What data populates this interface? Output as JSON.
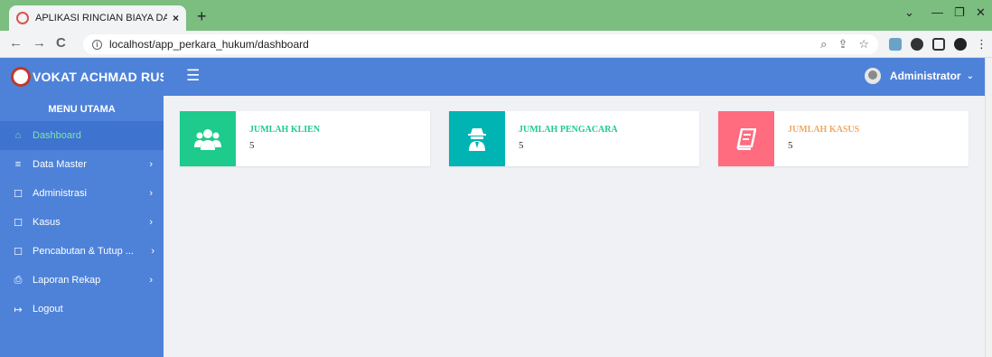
{
  "browser": {
    "tab_title": "APLIKASI RINCIAN BIAYA DAN AL",
    "tab_close": "×",
    "new_tab": "+",
    "url": "localhost/app_perkara_hukum/dashboard"
  },
  "header": {
    "brand": "VOKAT ACHMAD RUSI",
    "user_name": "Administrator"
  },
  "sidebar": {
    "heading": "MENU UTAMA",
    "items": [
      {
        "label": "Dashboard",
        "icon": "home-icon",
        "active": true,
        "has_arrow": false
      },
      {
        "label": "Data Master",
        "icon": "list-icon",
        "has_arrow": true
      },
      {
        "label": "Administrasi",
        "icon": "square-icon",
        "has_arrow": true
      },
      {
        "label": "Kasus",
        "icon": "square-icon",
        "has_arrow": true
      },
      {
        "label": "Pencabutan & Tutup ...",
        "icon": "square-icon",
        "has_arrow": true
      },
      {
        "label": "Laporan Rekap",
        "icon": "printer-icon",
        "has_arrow": true
      },
      {
        "label": "Logout",
        "icon": "logout-icon",
        "has_arrow": false
      }
    ]
  },
  "cards": [
    {
      "title": "JUMLAH KLIEN",
      "value": "5",
      "icon": "users-icon",
      "color": "#1ecb8c",
      "title_color": "#1ecb8c"
    },
    {
      "title": "JUMLAH PENGACARA",
      "value": "5",
      "icon": "detective-icon",
      "color": "#00b4b4",
      "title_color": "#1ecb8c"
    },
    {
      "title": "JUMLAH KASUS",
      "value": "5",
      "icon": "book-icon",
      "color": "#ff6b7f",
      "title_color": "#f0a860"
    }
  ],
  "colors": {
    "tabstrip": "#7cbd80",
    "header": "#4e82d9",
    "sidebar": "#4e82d9",
    "active_item_text": "#7fe5a9"
  }
}
